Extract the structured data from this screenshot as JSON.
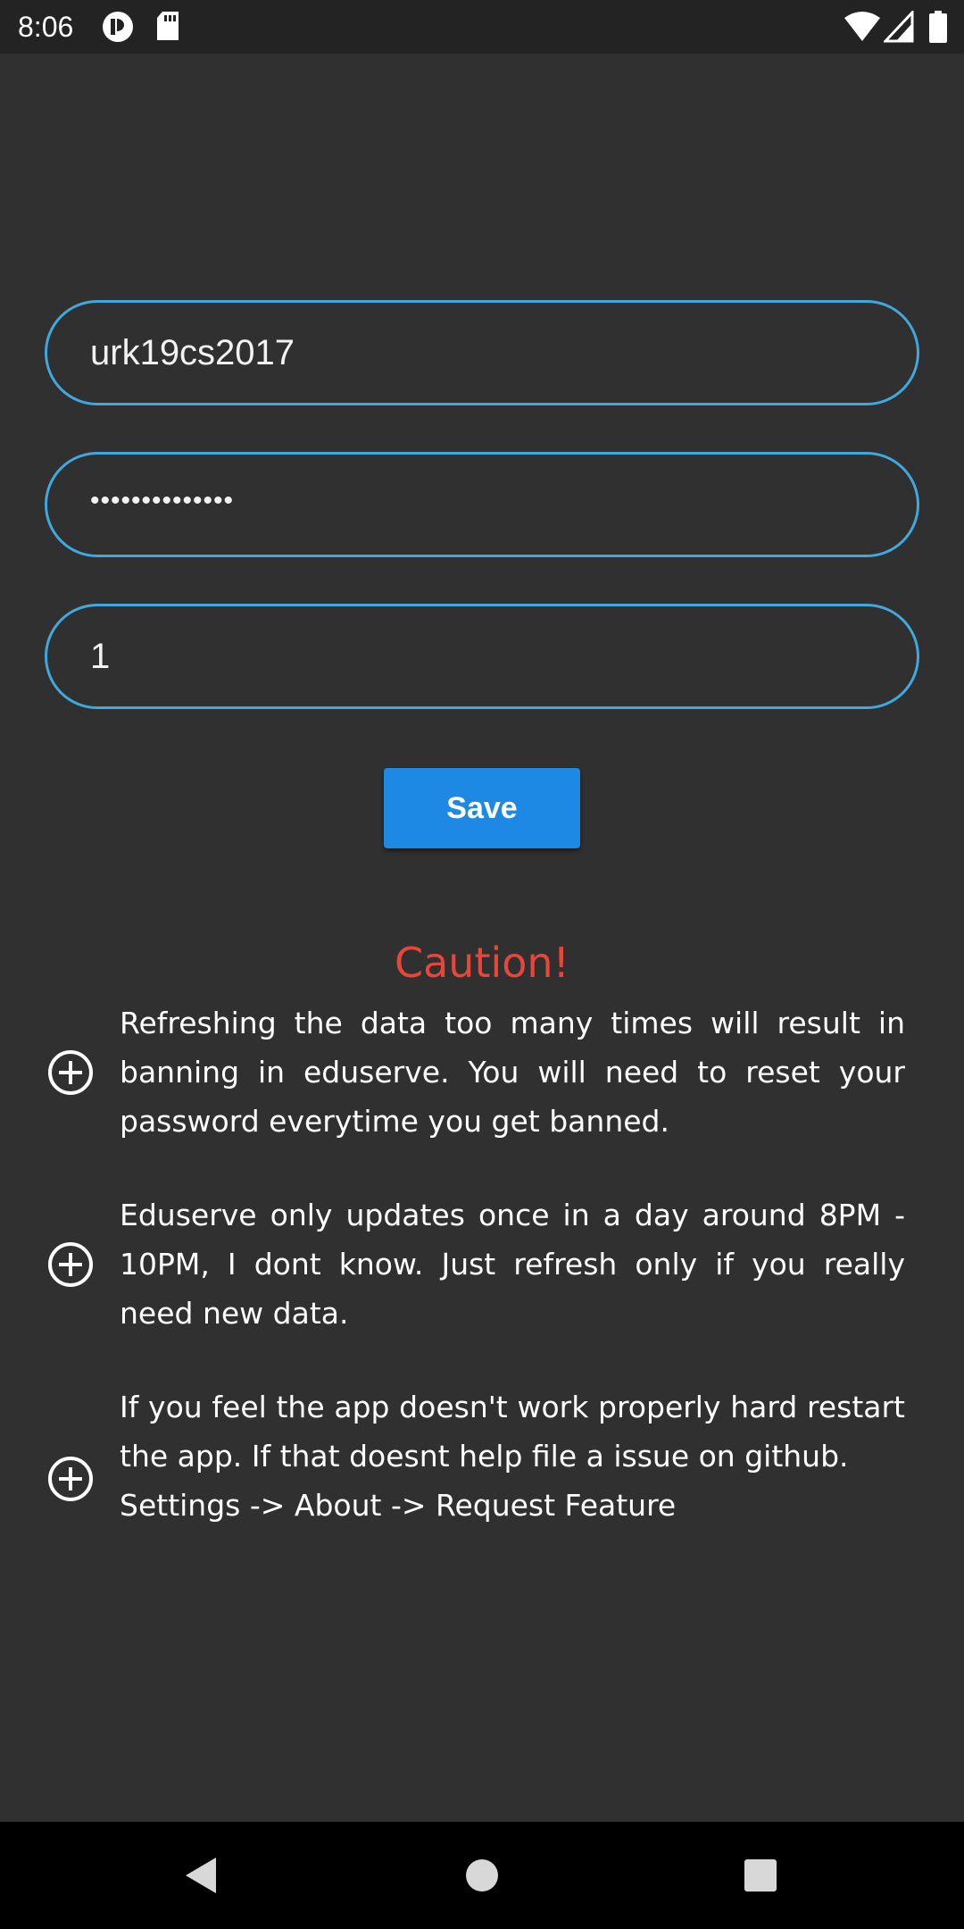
{
  "status_bar": {
    "time": "8:06",
    "icons": [
      "app-notification-icon",
      "sd-card-icon",
      "wifi-icon",
      "cell-signal-icon",
      "battery-icon"
    ]
  },
  "form": {
    "username_value": "urk19cs2017",
    "password_value": "••••••••••••••",
    "semester_value": "1",
    "save_label": "Save"
  },
  "caution": {
    "title": "Caution!",
    "title_color": "#e8463a",
    "notes": [
      {
        "icon": "plus-circle-icon",
        "text": "Refreshing the data too many times will result in banning in eduserve. You will need to reset your password everytime you get banned."
      },
      {
        "icon": "plus-circle-icon",
        "text": "Eduserve only updates once in a day around 8PM - 10PM, I dont know. Just refresh only if you really need new data."
      },
      {
        "icon": "plus-circle-icon",
        "text": "If you feel the app doesn't work properly hard restart the app. If that doesnt help file a issue on github.",
        "extra_line": "Settings -> About -> Request Feature"
      }
    ]
  },
  "nav_bar": {
    "icons": [
      "back-icon",
      "home-icon",
      "recents-icon"
    ]
  },
  "colors": {
    "background": "#303030",
    "field_border": "#3fa9de",
    "button": "#1e88e5"
  }
}
